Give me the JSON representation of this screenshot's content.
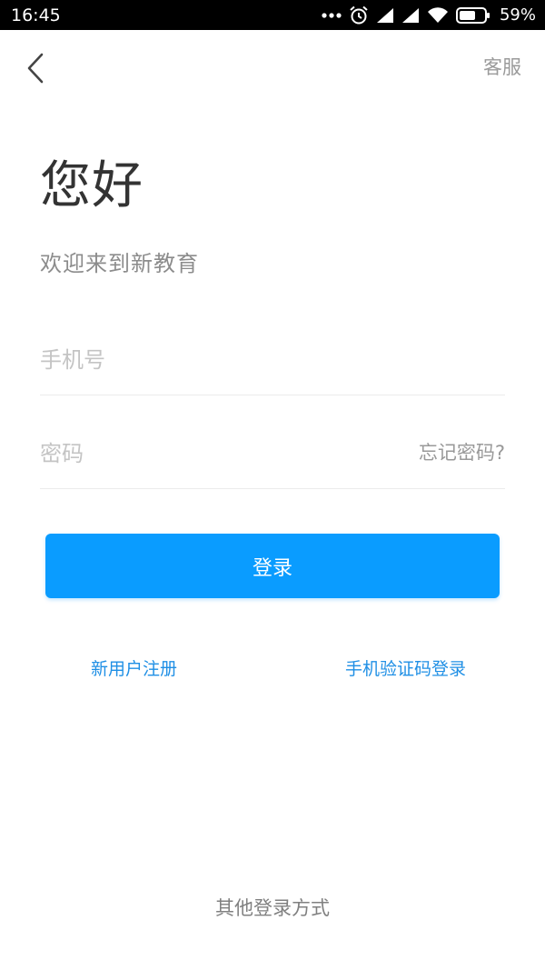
{
  "status_bar": {
    "time": "16:45",
    "battery_percent": "59%",
    "icons": [
      "more-dots-icon",
      "alarm-icon",
      "signal-icon",
      "signal-icon",
      "wifi-icon",
      "battery-icon"
    ]
  },
  "header": {
    "service_label": "客服"
  },
  "greeting": {
    "title": "您好",
    "subtitle": "欢迎来到新教育"
  },
  "form": {
    "phone_placeholder": "手机号",
    "password_placeholder": "密码",
    "forgot_label": "忘记密码?",
    "login_label": "登录"
  },
  "links": {
    "register_label": "新用户注册",
    "sms_login_label": "手机验证码登录"
  },
  "footer": {
    "other_login_label": "其他登录方式"
  },
  "colors": {
    "accent": "#0a9cff",
    "link": "#1f8fe5"
  }
}
